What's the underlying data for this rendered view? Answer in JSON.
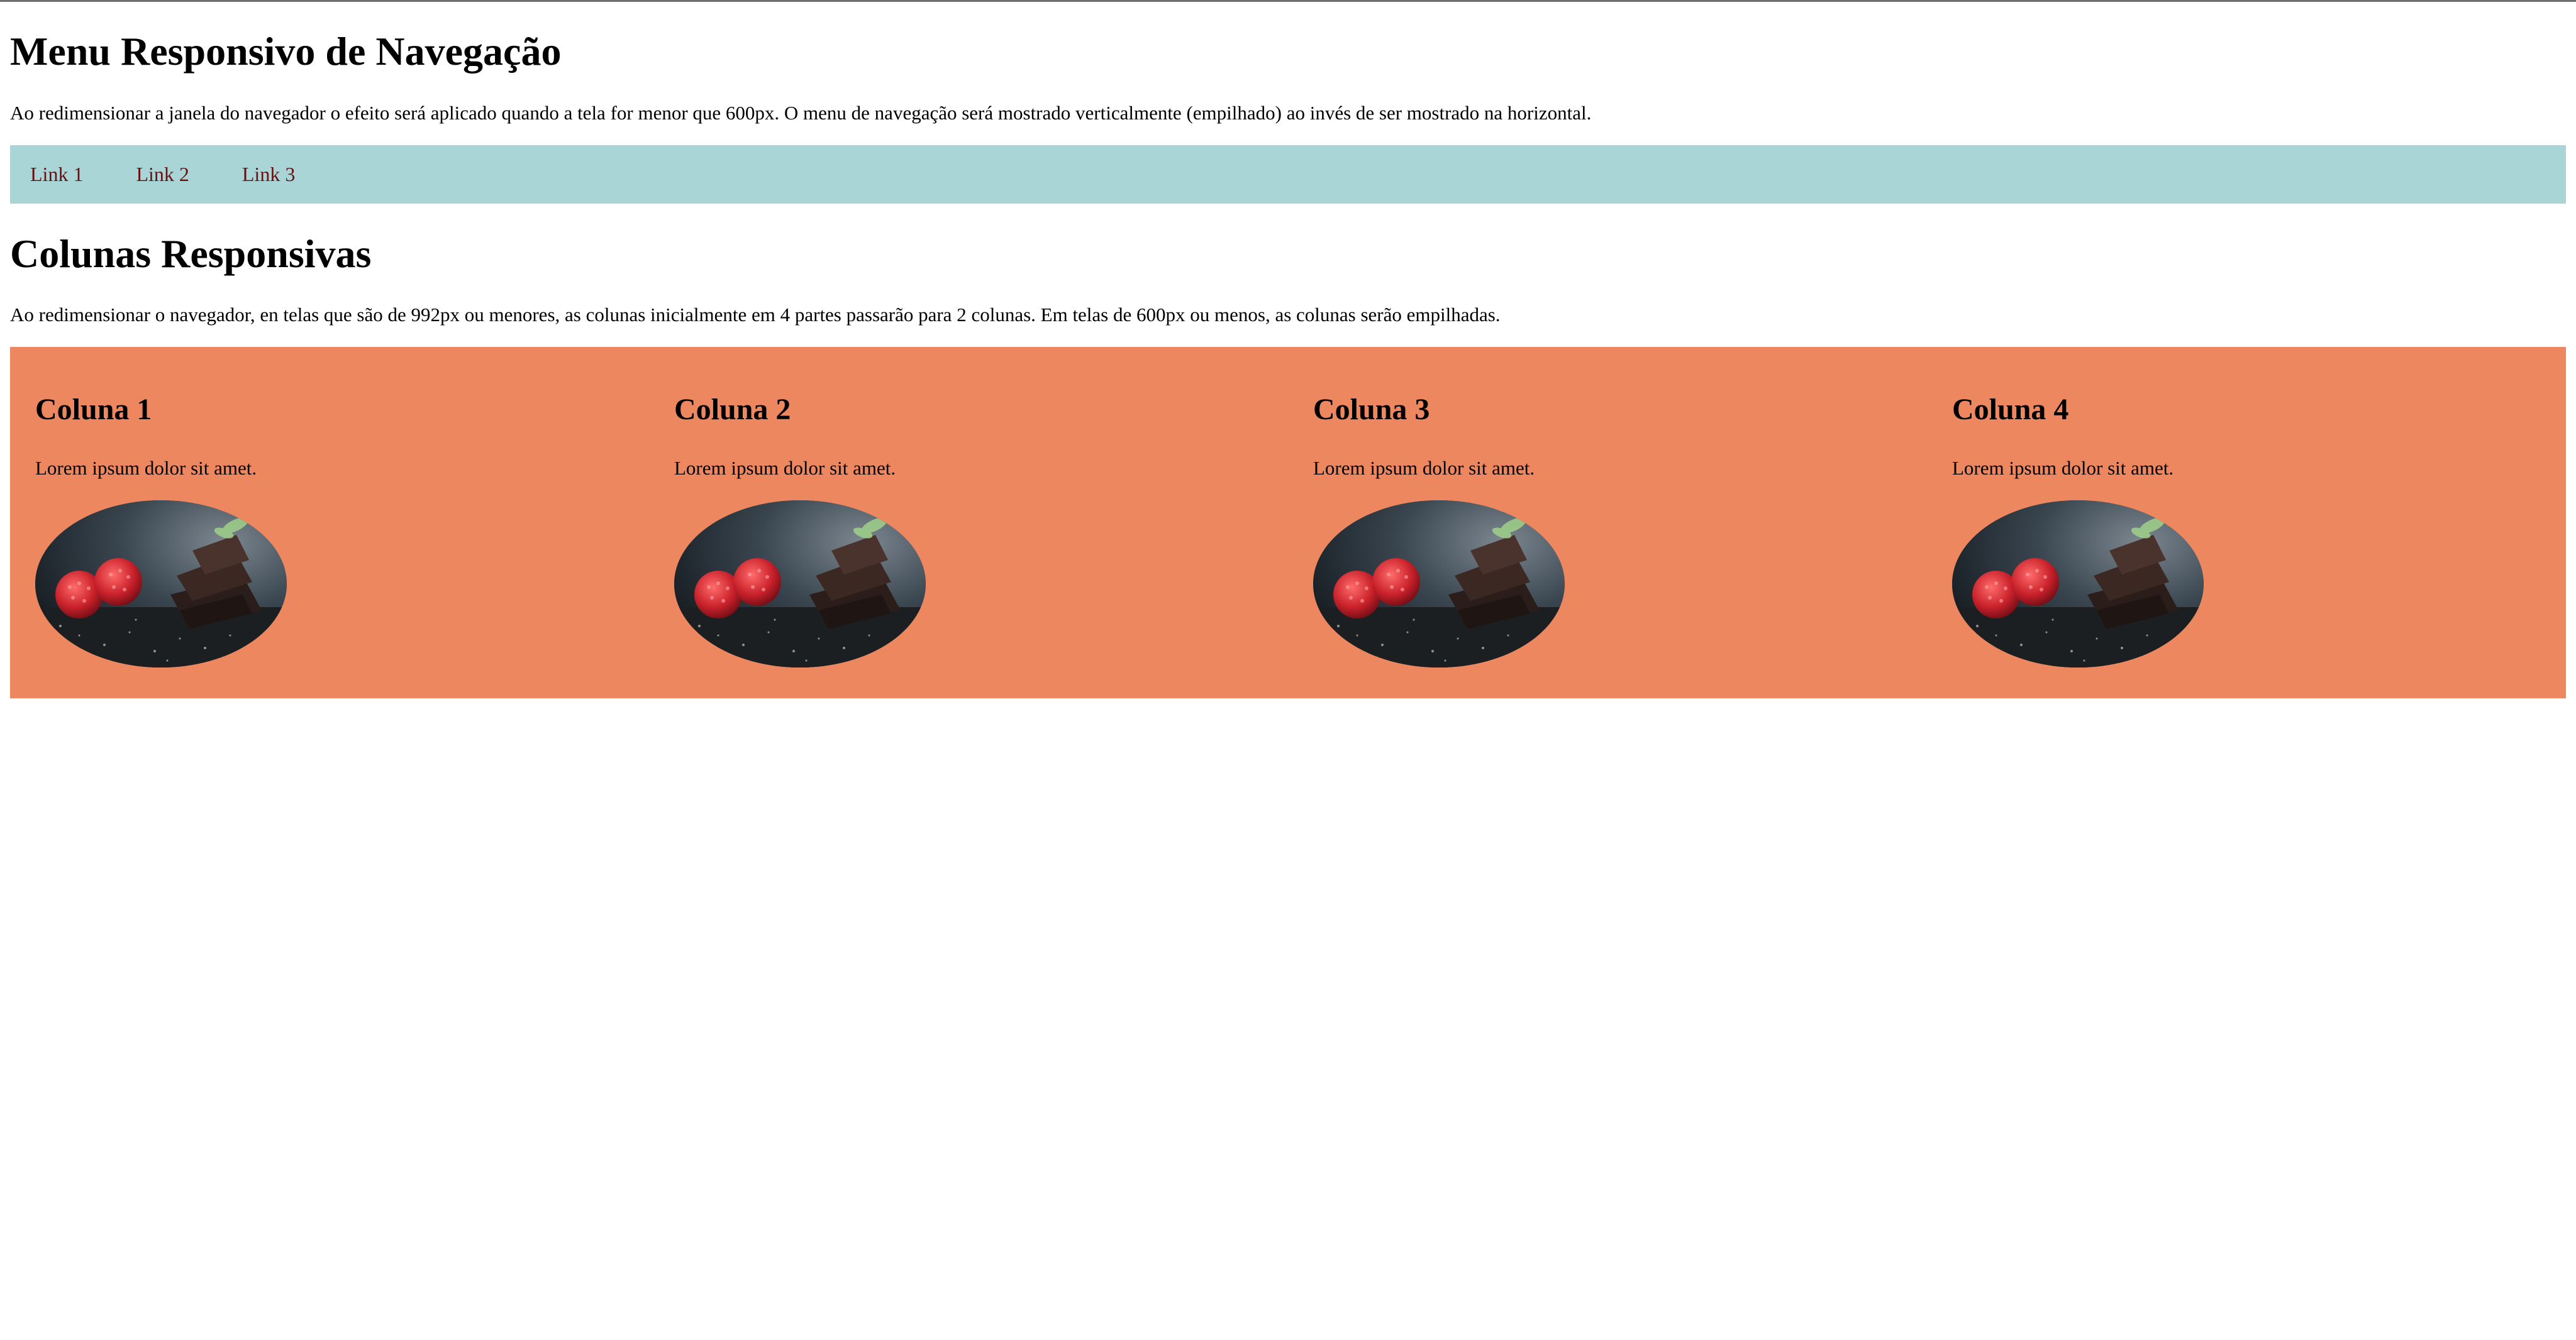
{
  "page": {
    "title": "Menu Responsivo de Navegação",
    "nav_description": "Ao redimensionar a janela do navegador o efeito será aplicado quando a tela for menor que 600px. O menu de navegação será mostrado verticalmente (empilhado) ao invés de ser mostrado na horizontal.",
    "nav": {
      "links": [
        "Link 1",
        "Link 2",
        "Link 3"
      ],
      "background": "#aad5d6",
      "link_color": "#6b1010"
    },
    "columns_title": "Colunas Responsivas",
    "columns_description": "Ao redimensionar o navegador, en telas que são de 992px ou menores, as colunas inicialmente em 4 partes passarão para 2 colunas. Em telas de 600px ou menos, as colunas serão empilhadas.",
    "columns": {
      "background": "#ec875f",
      "items": [
        {
          "heading": "Coluna 1",
          "text": "Lorem ipsum dolor sit amet.",
          "image": "raspberries-chocolate-photo"
        },
        {
          "heading": "Coluna 2",
          "text": "Lorem ipsum dolor sit amet.",
          "image": "raspberries-chocolate-photo"
        },
        {
          "heading": "Coluna 3",
          "text": "Lorem ipsum dolor sit amet.",
          "image": "raspberries-chocolate-photo"
        },
        {
          "heading": "Coluna 4",
          "text": "Lorem ipsum dolor sit amet.",
          "image": "raspberries-chocolate-photo"
        }
      ]
    }
  }
}
